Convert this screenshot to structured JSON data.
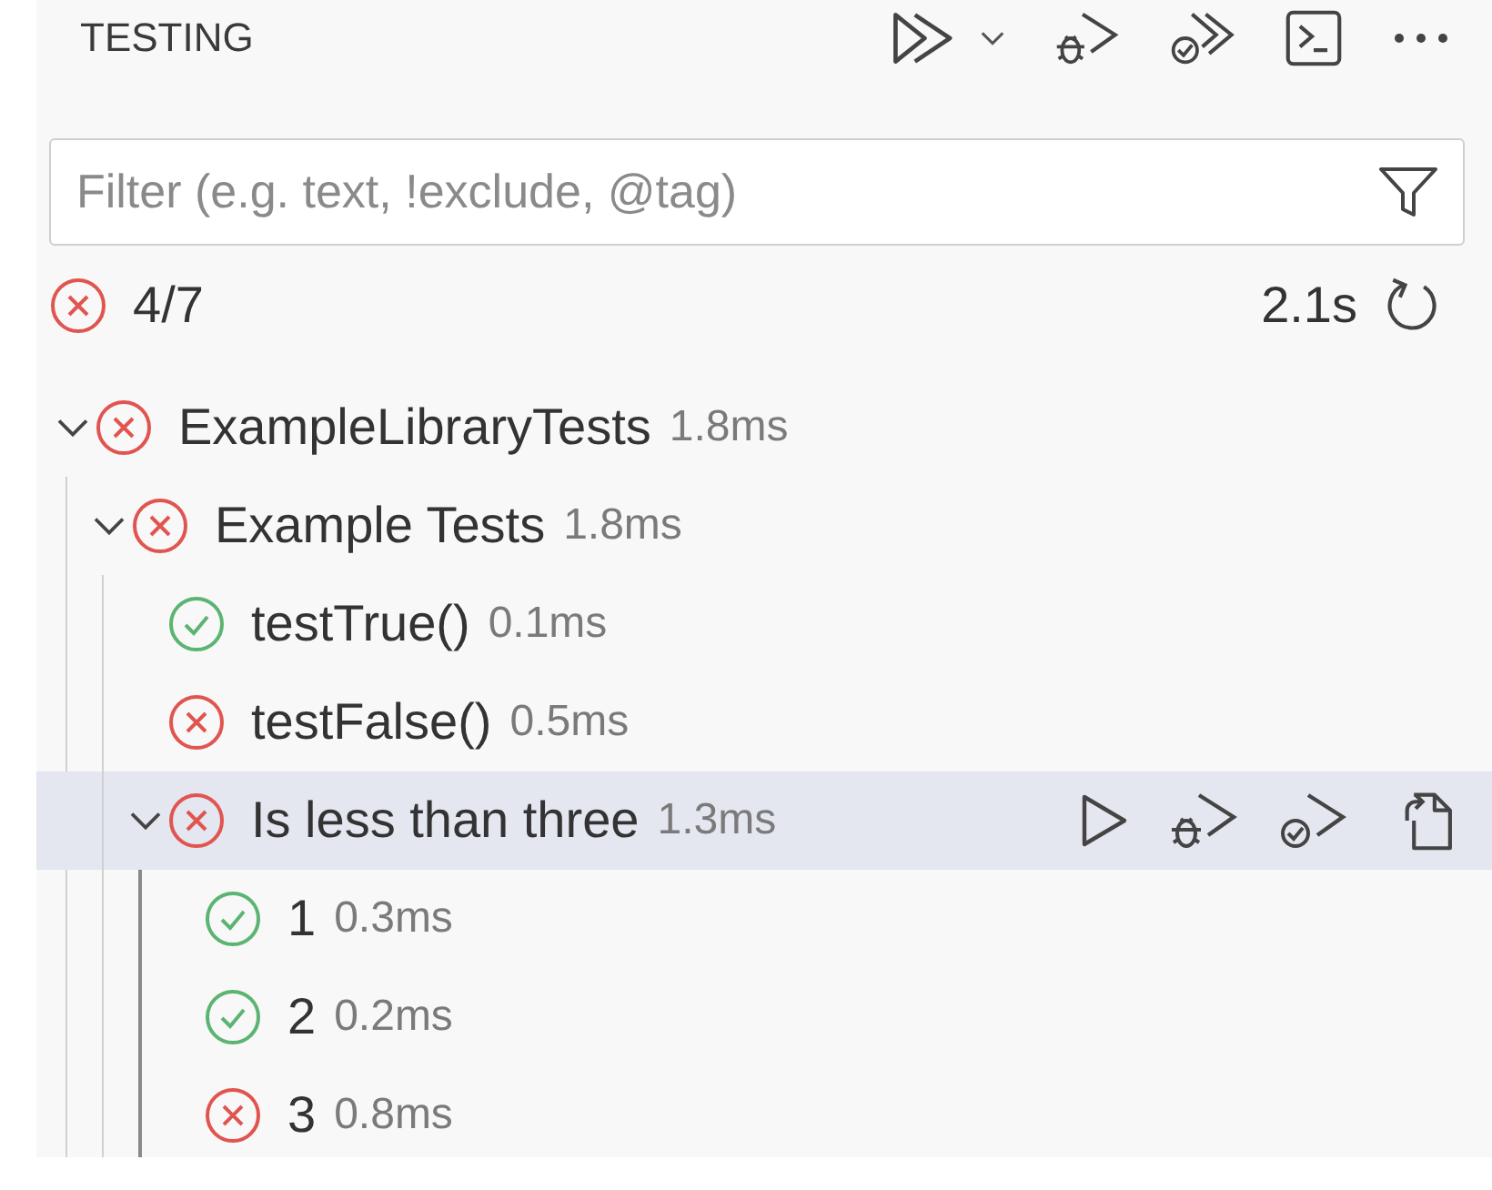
{
  "header": {
    "title": "TESTING"
  },
  "filter": {
    "placeholder": "Filter (e.g. text, !exclude, @tag)"
  },
  "summary": {
    "passed": false,
    "count": "4/7",
    "duration": "2.1s"
  },
  "tree": [
    {
      "label": "ExampleLibraryTests",
      "duration": "1.8ms",
      "passed": false,
      "expanded": true,
      "selected": false,
      "children": [
        {
          "label": "Example Tests",
          "duration": "1.8ms",
          "passed": false,
          "expanded": true,
          "selected": false,
          "children": [
            {
              "label": "testTrue()",
              "duration": "0.1ms",
              "passed": true,
              "selected": false
            },
            {
              "label": "testFalse()",
              "duration": "0.5ms",
              "passed": false,
              "selected": false
            },
            {
              "label": "Is less than three",
              "duration": "1.3ms",
              "passed": false,
              "expanded": true,
              "selected": true,
              "children": [
                {
                  "label": "1",
                  "duration": "0.3ms",
                  "passed": true,
                  "selected": false
                },
                {
                  "label": "2",
                  "duration": "0.2ms",
                  "passed": true,
                  "selected": false
                },
                {
                  "label": "3",
                  "duration": "0.8ms",
                  "passed": false,
                  "selected": false
                }
              ]
            }
          ]
        }
      ]
    }
  ]
}
